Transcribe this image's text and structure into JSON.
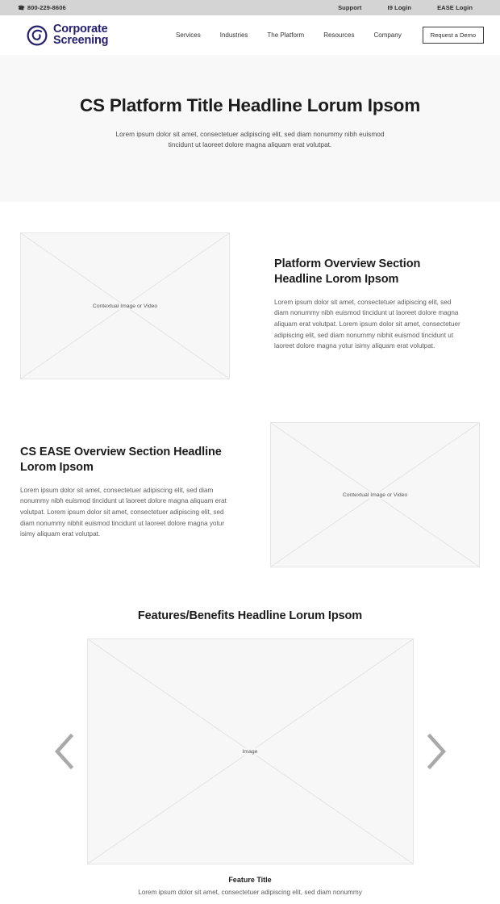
{
  "utility_bar": {
    "phone_icon": "phone-icon",
    "phone": "800-229-8606",
    "links": [
      {
        "label": "Support"
      },
      {
        "label": "I9 Login"
      },
      {
        "label": "EASE Login"
      }
    ]
  },
  "header": {
    "logo": {
      "icon": "corporate-screening-swirl-icon",
      "line1": "Corporate",
      "line2": "Screening",
      "color": "#241f6e"
    },
    "nav": [
      {
        "label": "Services"
      },
      {
        "label": "Industries"
      },
      {
        "label": "The Platform"
      },
      {
        "label": "Resources"
      },
      {
        "label": "Company"
      }
    ],
    "cta_label": "Request a Demo"
  },
  "hero": {
    "title": "CS Platform Title Headline Lorum Ipsom",
    "subtitle": "Lorem ipsum dolor sit amet, consectetuer adipiscing elit, sed diam nonummy nibh euismod tincidunt ut laoreet dolore magna aliquam erat volutpat.",
    "background": "#f8f8f8"
  },
  "platform_section": {
    "media_label": "Contextual Image or Video",
    "headline": "Platform Overview Section Headline Lorom Ipsom",
    "body": "Lorem ipsum dolor sit amet, consectetuer adipiscing elit, sed diam nonummy nibh euismod tincidunt ut laoreet dolore magna aliquam erat volutpat. Lorem ipsum dolor sit amet, consectetuer adipiscing elit, sed diam nonummy nibhit euismod tincidunt ut laoreet dolore magna yotur isimy aliquam erat volutpat."
  },
  "ease_section": {
    "headline": "CS EASE Overview Section Headline Lorom Ipsom",
    "body": "Lorem ipsum dolor sit amet, consectetuer adipiscing elit, sed diam nonummy nibh euismod tincidunt ut laoreet dolore magna aliquam erat volutpat. Lorem ipsum dolor sit amet, consectetuer adipiscing elit, sed diam nonummy nibhit euismod tincidunt ut laoreet dolore magna yotur isimy aliquam erat volutpat.",
    "media_label": "Contextual Image or Video"
  },
  "features_section": {
    "headline": "Features/Benefits Headline Lorum Ipsom",
    "prev_icon": "chevron-left-icon",
    "next_icon": "chevron-right-icon",
    "slide_label": "Image",
    "feature_title": "Feature Title",
    "feature_desc": "Lorem ipsum dolor sit amet, consectetuer adipiscing elit, sed diam nonummy"
  }
}
